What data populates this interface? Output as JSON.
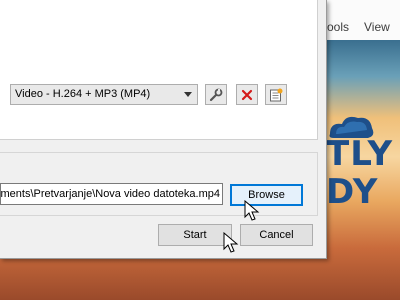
{
  "background_app": {
    "menu": [
      "ools",
      "View"
    ],
    "logo_text": "TLY\nDY"
  },
  "dialog": {
    "profile": {
      "selected": "Video - H.264 + MP3 (MP4)"
    },
    "icons": [
      "wrench-icon",
      "delete-icon",
      "new-profile-icon"
    ],
    "destination": {
      "file_path": "ments\\Pretvarjanje\\Nova video datoteka.mp4",
      "browse_label": "Browse"
    },
    "buttons": {
      "start_label": "Start",
      "cancel_label": "Cancel"
    }
  },
  "colors": {
    "accent": "#0078d7",
    "delete": "#d41a1a",
    "logo": "#1e4f8a"
  }
}
